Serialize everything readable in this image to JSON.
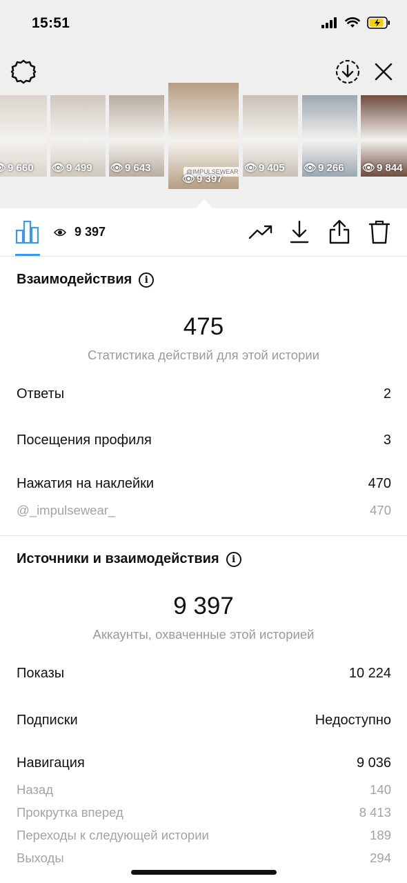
{
  "status_bar": {
    "time": "15:51"
  },
  "thumbnails": [
    {
      "views": "9 660",
      "bg": "#d9d4cc"
    },
    {
      "views": "9 499",
      "bg": "#cfc7bd"
    },
    {
      "views": "9 643",
      "bg": "#b9ada0"
    },
    {
      "views": "9 397",
      "bg": "#b59d80",
      "active": true,
      "tag": "@IMPULSEWEAR_"
    },
    {
      "views": "9 405",
      "bg": "#c9c1b6"
    },
    {
      "views": "9 266",
      "bg": "#9aa7b1"
    },
    {
      "views": "9 844",
      "bg": "#6f4c3e"
    }
  ],
  "stats_header": {
    "views": "9 397"
  },
  "interactions": {
    "title": "Взаимодействия",
    "total": "475",
    "caption": "Статистика действий для этой истории",
    "rows": [
      {
        "label": "Ответы",
        "value": "2"
      },
      {
        "label": "Посещения профиля",
        "value": "3"
      },
      {
        "label": "Нажатия на наклейки",
        "value": "470"
      }
    ],
    "sub_rows": [
      {
        "label": "@_impulsewear_",
        "value": "470"
      }
    ]
  },
  "discovery": {
    "title": "Источники и взаимодействия",
    "total": "9 397",
    "caption": "Аккаунты, охваченные этой историей",
    "rows": [
      {
        "label": "Показы",
        "value": "10 224"
      },
      {
        "label": "Подписки",
        "value": "Недоступно"
      },
      {
        "label": "Навигация",
        "value": "9 036"
      }
    ],
    "sub_rows": [
      {
        "label": "Назад",
        "value": "140"
      },
      {
        "label": "Прокрутка вперед",
        "value": "8 413"
      },
      {
        "label": "Переходы к следующей истории",
        "value": "189"
      },
      {
        "label": "Выходы",
        "value": "294"
      }
    ]
  },
  "colors": {
    "accent": "#3897f0",
    "battery": "#f5d000",
    "muted_text": "#9a9a9a"
  }
}
